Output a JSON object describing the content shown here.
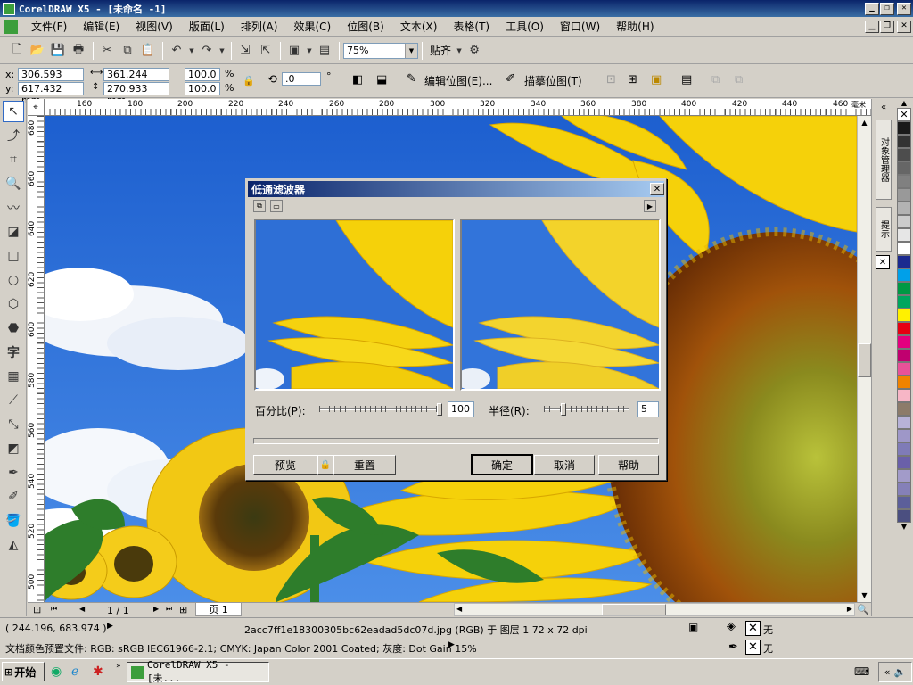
{
  "window": {
    "title": "CorelDRAW X5 - [未命名 -1]"
  },
  "menu": [
    "文件(F)",
    "编辑(E)",
    "视图(V)",
    "版面(L)",
    "排列(A)",
    "效果(C)",
    "位图(B)",
    "文本(X)",
    "表格(T)",
    "工具(O)",
    "窗口(W)",
    "帮助(H)"
  ],
  "toolbar": {
    "zoom": "75%",
    "snap_label": "贴齐"
  },
  "props": {
    "x_label": "x:",
    "x": "306.593 mm",
    "y_label": "y:",
    "y": "617.432 mm",
    "w": "361.244 mm",
    "h": "270.933 mm",
    "scale_x": "100.0",
    "scale_y": "100.0",
    "pct": "%",
    "rotation": ".0",
    "degree": "°",
    "edit_bitmap": "编辑位图(E)...",
    "trace_bitmap": "描摹位图(T)"
  },
  "ruler_h": [
    "160",
    "180",
    "200",
    "220",
    "240",
    "260",
    "280",
    "300",
    "320",
    "340",
    "360",
    "380",
    "400",
    "420",
    "440",
    "460"
  ],
  "ruler_h_unit": "毫米",
  "ruler_v": [
    "680",
    "660",
    "640",
    "620",
    "600",
    "580",
    "560",
    "540",
    "520",
    "500"
  ],
  "page_nav": {
    "count": "1 / 1",
    "tab": "页 1"
  },
  "dialog": {
    "title": "低通滤波器",
    "percent_label": "百分比(P):",
    "percent_value": "100",
    "percent_fraction": 1.0,
    "radius_label": "半径(R):",
    "radius_value": "5",
    "radius_fraction": 0.05,
    "preview": "预览",
    "reset": "重置",
    "ok": "确定",
    "cancel": "取消",
    "help": "帮助"
  },
  "docker": {
    "tab1": "对象管理器",
    "tab2": "提示"
  },
  "palette": [
    "#ffffff",
    "#1a1a1a",
    "#333333",
    "#4d4d4d",
    "#666666",
    "#808080",
    "#999999",
    "#b3b3b3",
    "#cccccc",
    "#e6e6e6",
    "#ffffff",
    "#1b2a8f",
    "#00a0e9",
    "#009944",
    "#00a65e",
    "#fff100",
    "#e60012",
    "#e4007f",
    "#c0006f",
    "#e85298",
    "#f08300",
    "#f7b6c6",
    "#8c7b6a",
    "#b7b2d8",
    "#9e97c8",
    "#7f7bb7",
    "#6a60a9",
    "#a29bc9",
    "#8580b8",
    "#5c5f9a",
    "#4b4f80"
  ],
  "status": {
    "coords": "( 244.196, 683.974 )",
    "info": "2acc7ff1e18300305bc62eadad5dc07d.jpg (RGB) 于 图层 1 72 x 72 dpi",
    "color_profile": "文档颜色预置文件: RGB: sRGB IEC61966-2.1; CMYK: Japan Color 2001 Coated; 灰度: Dot Gain 15%",
    "fill_none": "无",
    "outline_none": "无"
  },
  "taskbar": {
    "start": "开始",
    "task": "CorelDRAW X5 - [未..."
  }
}
